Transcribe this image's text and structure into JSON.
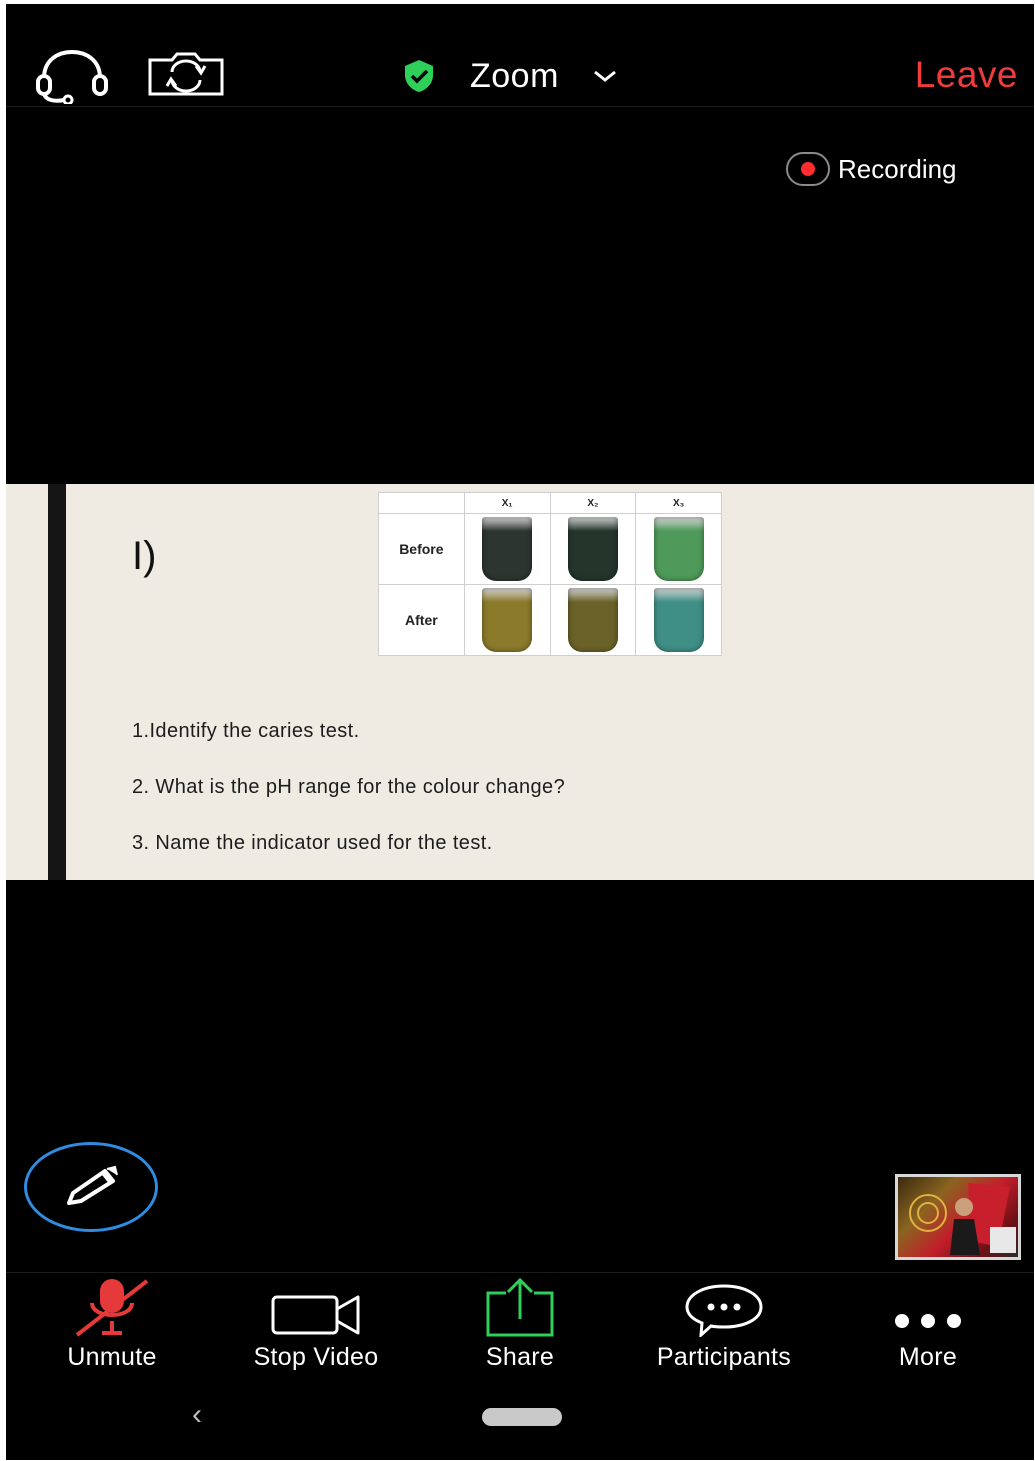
{
  "header": {
    "meeting_name": "Zoom",
    "leave_label": "Leave",
    "recording_label": "Recording"
  },
  "slide": {
    "letter": "I)",
    "table": {
      "columns": [
        "X₁",
        "X₂",
        "X₃"
      ],
      "rows": [
        {
          "label": "Before",
          "tube_colors": [
            "#2c3530",
            "#24352c",
            "#4f9a5a"
          ]
        },
        {
          "label": "After",
          "tube_colors": [
            "#8a7a2a",
            "#6a6228",
            "#3f8f86"
          ]
        }
      ]
    },
    "questions": [
      "1.Identify the caries test.",
      "2. What is the pH range for the colour change?",
      "3. Name the indicator used for the test."
    ]
  },
  "toolbar": {
    "unmute_label": "Unmute",
    "stop_video_label": "Stop Video",
    "share_label": "Share",
    "participants_label": "Participants",
    "more_label": "More"
  },
  "colors": {
    "leave": "#ef3b3b",
    "recording_dot": "#ff2d2d",
    "muted_mic": "#e5393a",
    "share_arrow": "#2fd05a",
    "secure_shield": "#2fd05a",
    "annotate_ring": "#2f8ce0"
  },
  "icons": {
    "top_left": [
      "headset-icon",
      "switch-camera-icon"
    ],
    "title": [
      "shield-check-icon",
      "chevron-down-icon"
    ],
    "toolbar": [
      "muted-mic-icon",
      "video-camera-icon",
      "share-arrow-icon",
      "chat-bubble-icon",
      "more-dots-icon"
    ],
    "annotate": "pencil-icon"
  }
}
